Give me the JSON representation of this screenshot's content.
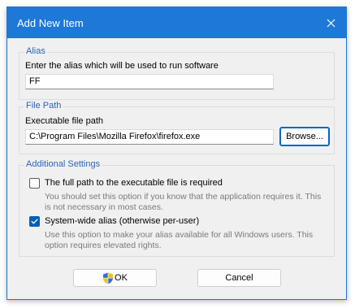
{
  "window": {
    "title": "Add New Item"
  },
  "alias": {
    "legend": "Alias",
    "label": "Enter the alias which will be used to run software",
    "value": "FF"
  },
  "file_path": {
    "legend": "File Path",
    "label": "Executable file path",
    "value": "C:\\Program Files\\Mozilla Firefox\\firefox.exe",
    "browse_label": "Browse..."
  },
  "additional": {
    "legend": "Additional Settings",
    "options": [
      {
        "label": "The full path to the executable file is required",
        "checked": false,
        "desc_line1": "You should set this option if you know that the application requires it. This",
        "desc_line2": "is not necessary in most cases."
      },
      {
        "label": "System-wide alias (otherwise per-user)",
        "checked": true,
        "desc_line1": "Use this option to make your alias available for all Windows users. This",
        "desc_line2": "option requires elevated rights."
      }
    ]
  },
  "buttons": {
    "ok": "OK",
    "cancel": "Cancel"
  },
  "icons": {
    "close": "close-icon",
    "ok_shield": "uac-shield-icon",
    "check": "checkmark-icon"
  },
  "colors": {
    "titlebar": "#1e78d8",
    "legend_text": "#2b64b8",
    "checkbox_checked": "#005fb8",
    "focus_border": "#0067c0"
  }
}
